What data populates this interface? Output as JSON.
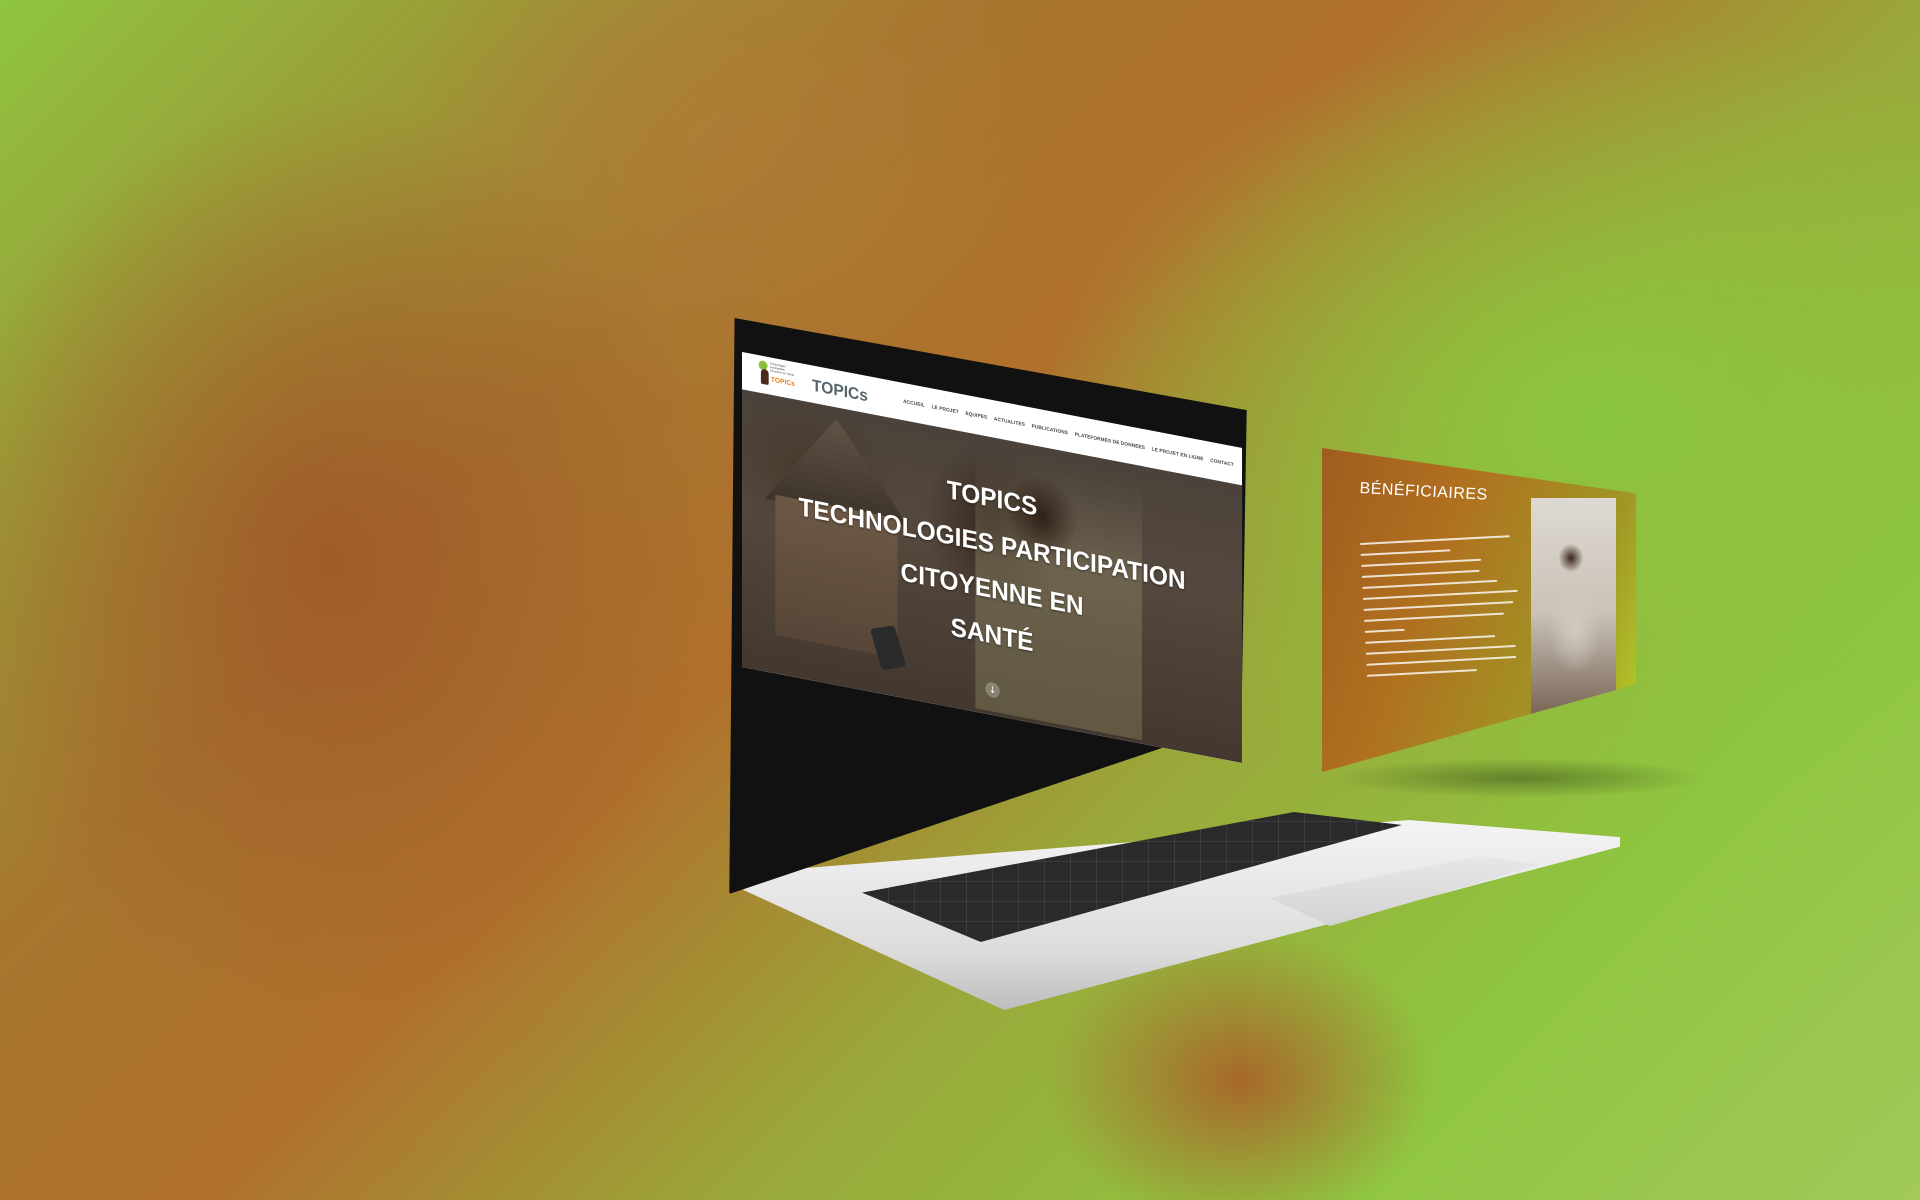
{
  "site": {
    "logo_small_text": "Technologies Participation Citoyenne en Santé",
    "logo_mark": "TOPICs",
    "brand_name": "TOPICs",
    "nav": [
      {
        "label": "ACCUEIL"
      },
      {
        "label": "LE PROJET"
      },
      {
        "label": "EQUIPES"
      },
      {
        "label": "ACTUALITES"
      },
      {
        "label": "PUBLICATIONS"
      },
      {
        "label": "PLATEFORMES DE DONNEES"
      },
      {
        "label": "LE PROJET EN LIGNE"
      },
      {
        "label": "CONTACT"
      }
    ],
    "hero": {
      "line1": "TOPICS",
      "line2": "TECHNOLOGIES PARTICIPATION",
      "line3": "CITOYENNE EN",
      "line4": "SANTÉ",
      "scroll_icon": "↓"
    }
  },
  "panel": {
    "title": "BÉNÉFICIAIRES",
    "photo_icon": "person-with-phone-photo"
  },
  "colors": {
    "brand_orange": "#e8811a",
    "brand_green": "#8bbf3b",
    "background_green": "#8fc540",
    "background_brown": "#a6762f"
  }
}
